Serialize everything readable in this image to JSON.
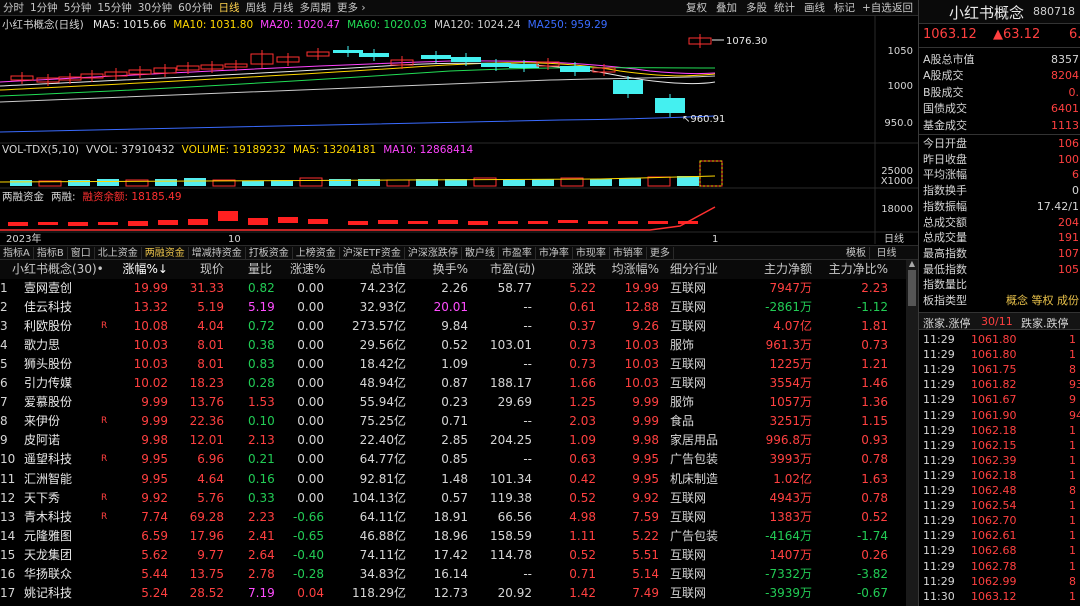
{
  "toolbar": {
    "items": [
      "分时",
      "1分钟",
      "5分钟",
      "15分钟",
      "30分钟",
      "60分钟",
      "日线",
      "周线",
      "月线",
      "多周期",
      "更多 ›"
    ],
    "active_index": 6,
    "right_items": [
      "复权",
      "叠加",
      "多股",
      "统计",
      "画线",
      "标记",
      "+自选",
      "返回"
    ]
  },
  "price_panel": {
    "title": "小红书概念(日线)",
    "ma_items": [
      {
        "label": "MA5: 1015.66",
        "color": "#e8e8e8"
      },
      {
        "label": "MA10: 1031.80",
        "color": "#ffd700"
      },
      {
        "label": "MA20: 1020.47",
        "color": "#ff44ff"
      },
      {
        "label": "MA60: 1020.03",
        "color": "#22dd55"
      },
      {
        "label": "MA120: 1024.24",
        "color": "#cccccc"
      },
      {
        "label": "MA250: 959.29",
        "color": "#3a6bff"
      }
    ],
    "y_ticks": [
      "1050",
      "1000",
      "950.0"
    ],
    "high_label": "1076.30",
    "low_label": "960.91"
  },
  "volume_panel": {
    "items": [
      {
        "label": "VOL-TDX(5,10)",
        "color": "#d6d6d6"
      },
      {
        "label": "VVOL: 37910432",
        "color": "#d6d6d6"
      },
      {
        "label": "VOLUME: 19189232",
        "color": "#ffd700"
      },
      {
        "label": "MA5: 13204181",
        "color": "#ffd700"
      },
      {
        "label": "MA10: 12868414",
        "color": "#ff44ff"
      }
    ],
    "y_ticks": [
      "25000",
      "X1000"
    ]
  },
  "margin_panel": {
    "items": [
      {
        "label": "两融资金",
        "color": "#d6d6d6"
      },
      {
        "label": "两融:",
        "color": "#d6d6d6"
      },
      {
        "label": "融资余额: 18185.49",
        "color": "#ff3030"
      }
    ],
    "y_ticks": [
      "18000"
    ]
  },
  "time_axis": {
    "labels": [
      "2023年",
      "10",
      "1"
    ],
    "period_label": "日线"
  },
  "tabs": {
    "items": [
      "指标A",
      "指标B",
      "窗口",
      "北上资金",
      "两融资金",
      "增减持资金",
      "打板资金",
      "上榜资金",
      "沪深ETF资金",
      "沪深涨跌停",
      "散户线",
      "市盈率",
      "市净率",
      "市现率",
      "市销率",
      "更多"
    ],
    "active_index": 4,
    "right": [
      "模板",
      "日线"
    ]
  },
  "table": {
    "headers": [
      "小红书概念(30)•",
      "涨幅%↓",
      "现价",
      "量比",
      "涨速%",
      "总市值",
      "换手%",
      "市盈(动)",
      "涨跌",
      "均涨幅%",
      "细分行业",
      "主力净额",
      "主力净比%"
    ],
    "rows": [
      {
        "n": "1",
        "name": "壹网壹创",
        "flag": "",
        "pct": "19.99",
        "price": "31.33",
        "vr": "0.82",
        "spd": "0.00",
        "cap": "74.23亿",
        "to": "2.26",
        "pe": "58.77",
        "chg": "5.22",
        "avg": "19.99",
        "ind": "互联网",
        "net": "7947万",
        "ratio": "2.23",
        "cp": "r",
        "cv": "g",
        "cs": "w",
        "cn": "r",
        "cto": "w"
      },
      {
        "n": "2",
        "name": "佳云科技",
        "flag": "",
        "pct": "13.32",
        "price": "5.19",
        "vr": "5.19",
        "spd": "0.00",
        "cap": "32.93亿",
        "to": "20.01",
        "pe": "--",
        "chg": "0.61",
        "avg": "12.88",
        "ind": "互联网",
        "net": "-2861万",
        "ratio": "-1.12",
        "cp": "r",
        "cv": "m",
        "cs": "w",
        "cn": "g",
        "cto": "m"
      },
      {
        "n": "3",
        "name": "利欧股份",
        "flag": "R",
        "pct": "10.08",
        "price": "4.04",
        "vr": "0.72",
        "spd": "0.00",
        "cap": "273.57亿",
        "to": "9.84",
        "pe": "--",
        "chg": "0.37",
        "avg": "9.26",
        "ind": "互联网",
        "net": "4.07亿",
        "ratio": "1.81",
        "cp": "r",
        "cv": "g",
        "cs": "w",
        "cn": "r",
        "cto": "w"
      },
      {
        "n": "4",
        "name": "歌力思",
        "flag": "",
        "pct": "10.03",
        "price": "8.01",
        "vr": "0.38",
        "spd": "0.00",
        "cap": "29.56亿",
        "to": "0.52",
        "pe": "103.01",
        "chg": "0.73",
        "avg": "10.03",
        "ind": "服饰",
        "net": "961.3万",
        "ratio": "0.73",
        "cp": "r",
        "cv": "g",
        "cs": "w",
        "cn": "r",
        "cto": "w"
      },
      {
        "n": "5",
        "name": "狮头股份",
        "flag": "",
        "pct": "10.03",
        "price": "8.01",
        "vr": "0.83",
        "spd": "0.00",
        "cap": "18.42亿",
        "to": "1.09",
        "pe": "--",
        "chg": "0.73",
        "avg": "10.03",
        "ind": "互联网",
        "net": "1225万",
        "ratio": "1.21",
        "cp": "r",
        "cv": "g",
        "cs": "w",
        "cn": "r",
        "cto": "w"
      },
      {
        "n": "6",
        "name": "引力传媒",
        "flag": "",
        "pct": "10.02",
        "price": "18.23",
        "vr": "0.28",
        "spd": "0.00",
        "cap": "48.94亿",
        "to": "0.87",
        "pe": "188.17",
        "chg": "1.66",
        "avg": "10.03",
        "ind": "互联网",
        "net": "3554万",
        "ratio": "1.46",
        "cp": "r",
        "cv": "g",
        "cs": "w",
        "cn": "r",
        "cto": "w"
      },
      {
        "n": "7",
        "name": "爱慕股份",
        "flag": "",
        "pct": "9.99",
        "price": "13.76",
        "vr": "1.53",
        "spd": "0.00",
        "cap": "55.94亿",
        "to": "0.23",
        "pe": "29.69",
        "chg": "1.25",
        "avg": "9.99",
        "ind": "服饰",
        "net": "1057万",
        "ratio": "1.36",
        "cp": "r",
        "cv": "r",
        "cs": "w",
        "cn": "r",
        "cto": "w"
      },
      {
        "n": "8",
        "name": "来伊份",
        "flag": "R",
        "pct": "9.99",
        "price": "22.36",
        "vr": "0.10",
        "spd": "0.00",
        "cap": "75.25亿",
        "to": "0.71",
        "pe": "--",
        "chg": "2.03",
        "avg": "9.99",
        "ind": "食品",
        "net": "3251万",
        "ratio": "1.15",
        "cp": "r",
        "cv": "g",
        "cs": "w",
        "cn": "r",
        "cto": "w"
      },
      {
        "n": "9",
        "name": "皮阿诺",
        "flag": "",
        "pct": "9.98",
        "price": "12.01",
        "vr": "2.13",
        "spd": "0.00",
        "cap": "22.40亿",
        "to": "2.85",
        "pe": "204.25",
        "chg": "1.09",
        "avg": "9.98",
        "ind": "家居用品",
        "net": "996.8万",
        "ratio": "0.93",
        "cp": "r",
        "cv": "r",
        "cs": "w",
        "cn": "r",
        "cto": "w"
      },
      {
        "n": "10",
        "name": "遥望科技",
        "flag": "R",
        "pct": "9.95",
        "price": "6.96",
        "vr": "0.21",
        "spd": "0.00",
        "cap": "64.77亿",
        "to": "0.85",
        "pe": "--",
        "chg": "0.63",
        "avg": "9.95",
        "ind": "广告包装",
        "net": "3993万",
        "ratio": "0.78",
        "cp": "r",
        "cv": "g",
        "cs": "w",
        "cn": "r",
        "cto": "w"
      },
      {
        "n": "11",
        "name": "汇洲智能",
        "flag": "",
        "pct": "9.95",
        "price": "4.64",
        "vr": "0.16",
        "spd": "0.00",
        "cap": "92.81亿",
        "to": "1.48",
        "pe": "101.34",
        "chg": "0.42",
        "avg": "9.95",
        "ind": "机床制造",
        "net": "1.02亿",
        "ratio": "1.63",
        "cp": "r",
        "cv": "g",
        "cs": "w",
        "cn": "r",
        "cto": "w"
      },
      {
        "n": "12",
        "name": "天下秀",
        "flag": "R",
        "pct": "9.92",
        "price": "5.76",
        "vr": "0.33",
        "spd": "0.00",
        "cap": "104.13亿",
        "to": "0.57",
        "pe": "119.38",
        "chg": "0.52",
        "avg": "9.92",
        "ind": "互联网",
        "net": "4943万",
        "ratio": "0.78",
        "cp": "r",
        "cv": "g",
        "cs": "w",
        "cn": "r",
        "cto": "w"
      },
      {
        "n": "13",
        "name": "青木科技",
        "flag": "R",
        "pct": "7.74",
        "price": "69.28",
        "vr": "2.23",
        "spd": "-0.66",
        "cap": "64.11亿",
        "to": "18.91",
        "pe": "66.56",
        "chg": "4.98",
        "avg": "7.59",
        "ind": "互联网",
        "net": "1383万",
        "ratio": "0.52",
        "cp": "r",
        "cv": "r",
        "cs": "g",
        "cn": "r",
        "cto": "w"
      },
      {
        "n": "14",
        "name": "元隆雅图",
        "flag": "",
        "pct": "6.59",
        "price": "17.96",
        "vr": "2.41",
        "spd": "-0.65",
        "cap": "46.88亿",
        "to": "18.96",
        "pe": "158.59",
        "chg": "1.11",
        "avg": "5.22",
        "ind": "广告包装",
        "net": "-4164万",
        "ratio": "-1.74",
        "cp": "r",
        "cv": "r",
        "cs": "g",
        "cn": "g",
        "cto": "w"
      },
      {
        "n": "15",
        "name": "天龙集团",
        "flag": "",
        "pct": "5.62",
        "price": "9.77",
        "vr": "2.64",
        "spd": "-0.40",
        "cap": "74.11亿",
        "to": "17.42",
        "pe": "114.78",
        "chg": "0.52",
        "avg": "5.51",
        "ind": "互联网",
        "net": "1407万",
        "ratio": "0.26",
        "cp": "r",
        "cv": "r",
        "cs": "g",
        "cn": "r",
        "cto": "w"
      },
      {
        "n": "16",
        "name": "华扬联众",
        "flag": "",
        "pct": "5.44",
        "price": "13.75",
        "vr": "2.78",
        "spd": "-0.28",
        "cap": "34.83亿",
        "to": "16.14",
        "pe": "--",
        "chg": "0.71",
        "avg": "5.14",
        "ind": "互联网",
        "net": "-7332万",
        "ratio": "-3.82",
        "cp": "r",
        "cv": "r",
        "cs": "g",
        "cn": "g",
        "cto": "w"
      },
      {
        "n": "17",
        "name": "姚记科技",
        "flag": "",
        "pct": "5.24",
        "price": "28.52",
        "vr": "7.19",
        "spd": "0.04",
        "cap": "118.29亿",
        "to": "12.73",
        "pe": "20.92",
        "chg": "1.42",
        "avg": "7.49",
        "ind": "互联网",
        "net": "-3939万",
        "ratio": "-0.67",
        "cp": "r",
        "cv": "m",
        "cs": "r",
        "cn": "g",
        "cto": "w"
      }
    ]
  },
  "right_panel": {
    "title": "小红书概念",
    "code": "880718",
    "price": "1063.12",
    "change": "▲63.12",
    "change_pct": "6.",
    "stats": [
      {
        "k": "A股总市值",
        "v": "8357"
      },
      {
        "k": "A股成交",
        "v": "8204"
      },
      {
        "k": "B股成交",
        "v": "0."
      },
      {
        "k": "国债成交",
        "v": "6401"
      },
      {
        "k": "基金成交",
        "v": "1113"
      },
      {
        "k": "今日开盘",
        "v": "106"
      },
      {
        "k": "昨日收盘",
        "v": "100"
      },
      {
        "k": "平均涨幅",
        "v": "6"
      },
      {
        "k": "指数换手",
        "v": "0"
      },
      {
        "k": "指数振幅",
        "v": "17.42/1"
      },
      {
        "k": "总成交额",
        "v": "204"
      },
      {
        "k": "总成交量",
        "v": "191"
      },
      {
        "k": "最高指数",
        "v": "107"
      },
      {
        "k": "最低指数",
        "v": "105"
      },
      {
        "k": "指数量比",
        "v": ""
      },
      {
        "k": "板指类型",
        "v": "概念 等权 成份"
      }
    ],
    "updown": {
      "label1": "涨家.涨停",
      "val1": "30/11",
      "label2": "跌家.跌停",
      "val2": ""
    },
    "ticks": [
      {
        "t": "11:29",
        "p": "1061.80",
        "x": "1"
      },
      {
        "t": "11:29",
        "p": "1061.80",
        "x": "1"
      },
      {
        "t": "11:29",
        "p": "1061.75",
        "x": "8"
      },
      {
        "t": "11:29",
        "p": "1061.82",
        "x": "93"
      },
      {
        "t": "11:29",
        "p": "1061.67",
        "x": "9"
      },
      {
        "t": "11:29",
        "p": "1061.90",
        "x": "94"
      },
      {
        "t": "11:29",
        "p": "1062.18",
        "x": "1"
      },
      {
        "t": "11:29",
        "p": "1062.15",
        "x": "1"
      },
      {
        "t": "11:29",
        "p": "1062.39",
        "x": "1"
      },
      {
        "t": "11:29",
        "p": "1062.18",
        "x": "1"
      },
      {
        "t": "11:29",
        "p": "1062.48",
        "x": "8"
      },
      {
        "t": "11:29",
        "p": "1062.54",
        "x": "1"
      },
      {
        "t": "11:29",
        "p": "1062.70",
        "x": "1"
      },
      {
        "t": "11:29",
        "p": "1062.61",
        "x": "1"
      },
      {
        "t": "11:29",
        "p": "1062.68",
        "x": "1"
      },
      {
        "t": "11:29",
        "p": "1062.78",
        "x": "1"
      },
      {
        "t": "11:29",
        "p": "1062.99",
        "x": "8"
      },
      {
        "t": "11:30",
        "p": "1063.12",
        "x": "1"
      }
    ]
  }
}
